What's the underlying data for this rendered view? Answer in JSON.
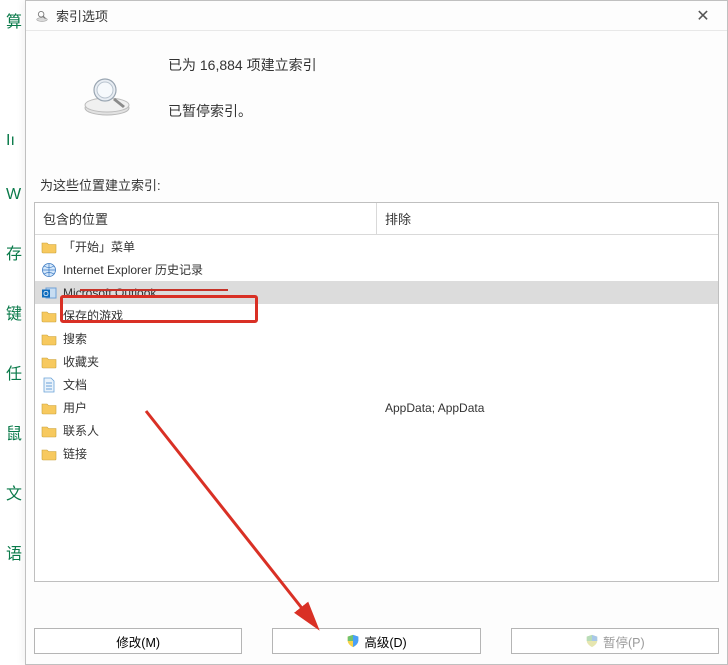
{
  "titlebar": {
    "title": "索引选项"
  },
  "status": {
    "indexed": "已为 16,884 项建立索引",
    "paused": "已暂停索引。"
  },
  "section_label": "为这些位置建立索引:",
  "columns": {
    "included": "包含的位置",
    "excluded": "排除"
  },
  "rows": [
    {
      "icon": "folder",
      "label": "「开始」菜单",
      "excluded": ""
    },
    {
      "icon": "globe",
      "label": "Internet Explorer 历史记录",
      "excluded": "",
      "strike": true
    },
    {
      "icon": "outlook",
      "label": "Microsoft Outlook",
      "excluded": "",
      "selected": true,
      "highlighted": true
    },
    {
      "icon": "folder",
      "label": "保存的游戏",
      "excluded": ""
    },
    {
      "icon": "folder",
      "label": "搜索",
      "excluded": ""
    },
    {
      "icon": "folder",
      "label": "收藏夹",
      "excluded": ""
    },
    {
      "icon": "doc",
      "label": "文档",
      "excluded": ""
    },
    {
      "icon": "folder",
      "label": "用户",
      "excluded": "AppData; AppData"
    },
    {
      "icon": "folder",
      "label": "联系人",
      "excluded": ""
    },
    {
      "icon": "folder",
      "label": "链接",
      "excluded": ""
    }
  ],
  "buttons": {
    "modify": "修改(M)",
    "advanced": "高级(D)",
    "pause": "暂停(P)"
  },
  "bgletters": [
    "算",
    "Iı",
    "W",
    "存",
    "键",
    "任",
    "鼠",
    "文",
    "语"
  ]
}
